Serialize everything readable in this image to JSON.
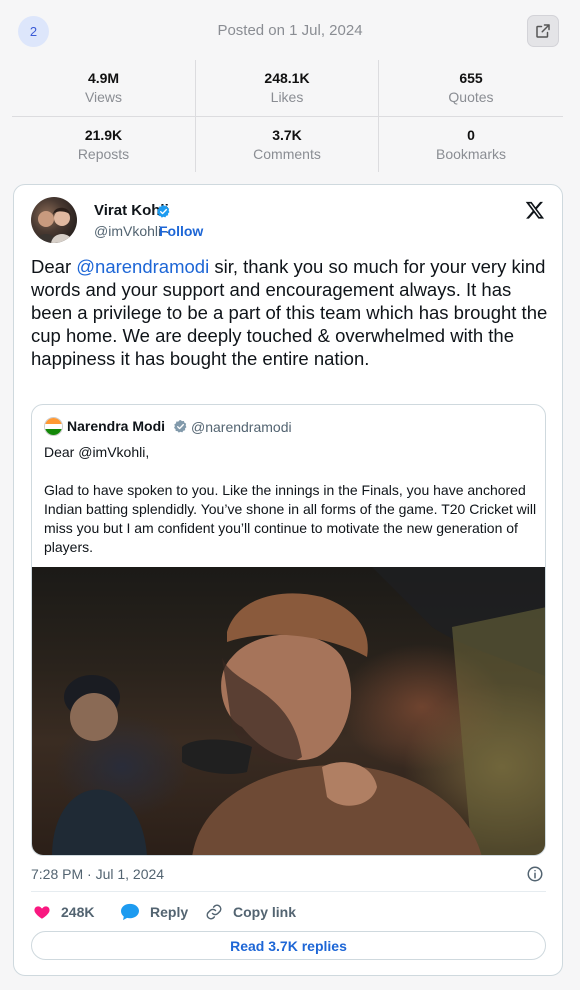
{
  "header": {
    "rank": "2",
    "posted_on": "Posted on 1 Jul, 2024"
  },
  "stats": [
    {
      "value": "4.9M",
      "label": "Views"
    },
    {
      "value": "248.1K",
      "label": "Likes"
    },
    {
      "value": "655",
      "label": "Quotes"
    },
    {
      "value": "21.9K",
      "label": "Reposts"
    },
    {
      "value": "3.7K",
      "label": "Comments"
    },
    {
      "value": "0",
      "label": "Bookmarks"
    }
  ],
  "tweet": {
    "author_name": "Virat Kohli",
    "author_handle": "@imVkohli",
    "handle_separator": "·",
    "follow_label": "Follow",
    "text_pre": "Dear ",
    "mention": "@narendramodi",
    "text_post": " sir, thank you so much for your very kind words and your support and encouragement always. It has been a privilege to be a part of this team which has brought the cup home. We are deeply touched & overwhelmed with the happiness it has bought the entire nation.",
    "timestamp": "7:28 PM · Jul 1, 2024",
    "like_count": "248K",
    "reply_label": "Reply",
    "copy_link_label": "Copy link",
    "read_replies_label": "Read 3.7K replies"
  },
  "quote": {
    "author_name": "Narendra Modi",
    "author_handle": "@narendramodi",
    "line1": "Dear @imVkohli,",
    "line2": "Glad to have spoken to you. Like the  innings in the Finals, you have anchored Indian batting splendidly. You’ve shone in all forms of the game. T20 Cricket will miss you but I am confident you’ll continue to motivate the new generation of players."
  },
  "colors": {
    "accent_blue": "#1d66d6",
    "verified_blue": "#1d9bf0",
    "like_pink": "#f91880",
    "reply_blue": "#1d9bf0"
  },
  "icons": {
    "open": "external-link-icon",
    "verified": "verified-badge-icon",
    "x_logo": "x-logo-icon",
    "info": "info-icon",
    "like": "heart-icon",
    "reply": "speech-bubble-icon",
    "copy_link": "link-icon"
  }
}
